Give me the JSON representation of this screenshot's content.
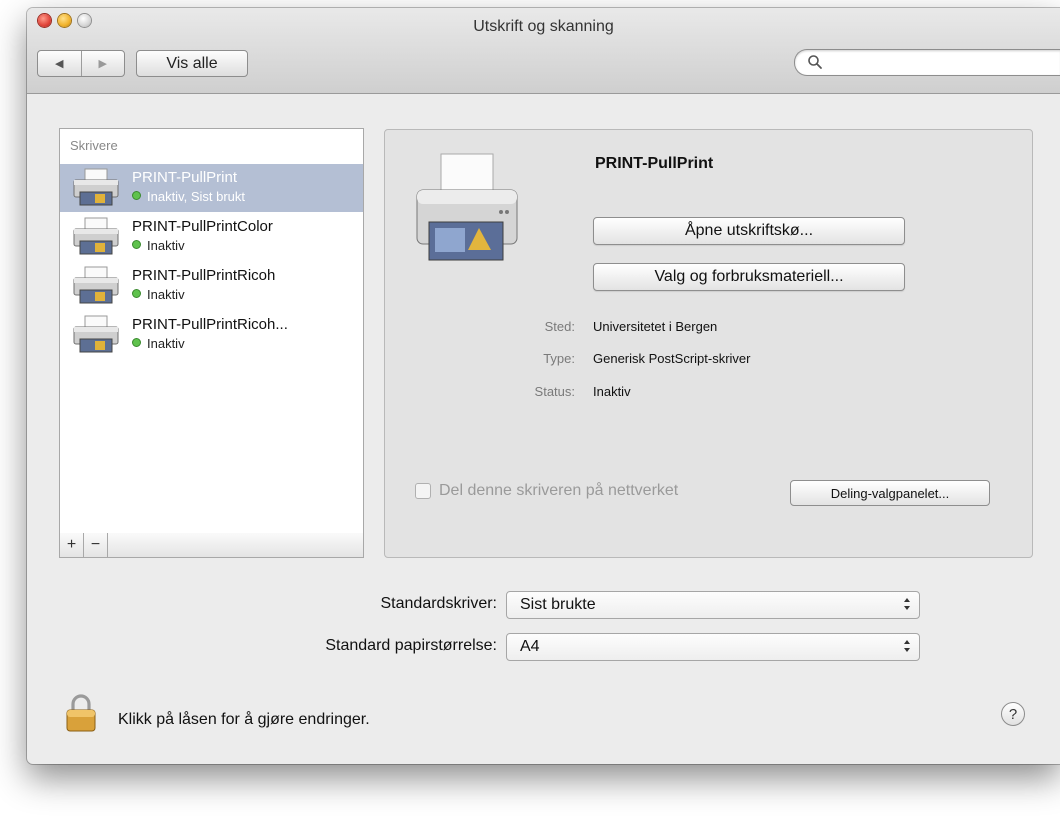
{
  "window": {
    "title": "Utskrift og skanning"
  },
  "toolbar": {
    "back_glyph": "◀",
    "forward_glyph": "▶",
    "show_all_label": "Vis alle",
    "search_placeholder": "",
    "search_value": ""
  },
  "printers": {
    "header": "Skrivere",
    "items": [
      {
        "name": "PRINT-PullPrint",
        "status": "Inaktiv, Sist brukt",
        "selected": true
      },
      {
        "name": "PRINT-PullPrintColor",
        "status": "Inaktiv",
        "selected": false
      },
      {
        "name": "PRINT-PullPrintRicoh",
        "status": "Inaktiv",
        "selected": false
      },
      {
        "name": "PRINT-PullPrintRicoh...",
        "status": "Inaktiv",
        "selected": false
      }
    ],
    "add_label": "+",
    "remove_label": "−"
  },
  "detail": {
    "printer_name": "PRINT-PullPrint",
    "open_queue_label": "Åpne utskriftskø...",
    "options_label": "Valg og forbruksmateriell...",
    "location_label": "Sted:",
    "location_value": "Universitetet i Bergen",
    "type_label": "Type:",
    "type_value": "Generisk PostScript-skriver",
    "status_label": "Status:",
    "status_value": "Inaktiv",
    "share_label": "Del denne skriveren på nettverket",
    "share_checked": false,
    "sharing_prefs_label": "Deling-valgpanelet..."
  },
  "defaults": {
    "printer_label": "Standardskriver:",
    "printer_value": "Sist brukte",
    "paper_label": "Standard papirstørrelse:",
    "paper_value": "A4"
  },
  "footer": {
    "lock_text": "Klikk på låsen for å gjøre endringer.",
    "help_label": "?"
  },
  "colors": {
    "selection": "#b4bfd4",
    "status_dot": "#5fc24d",
    "window_bg": "#ececec"
  }
}
